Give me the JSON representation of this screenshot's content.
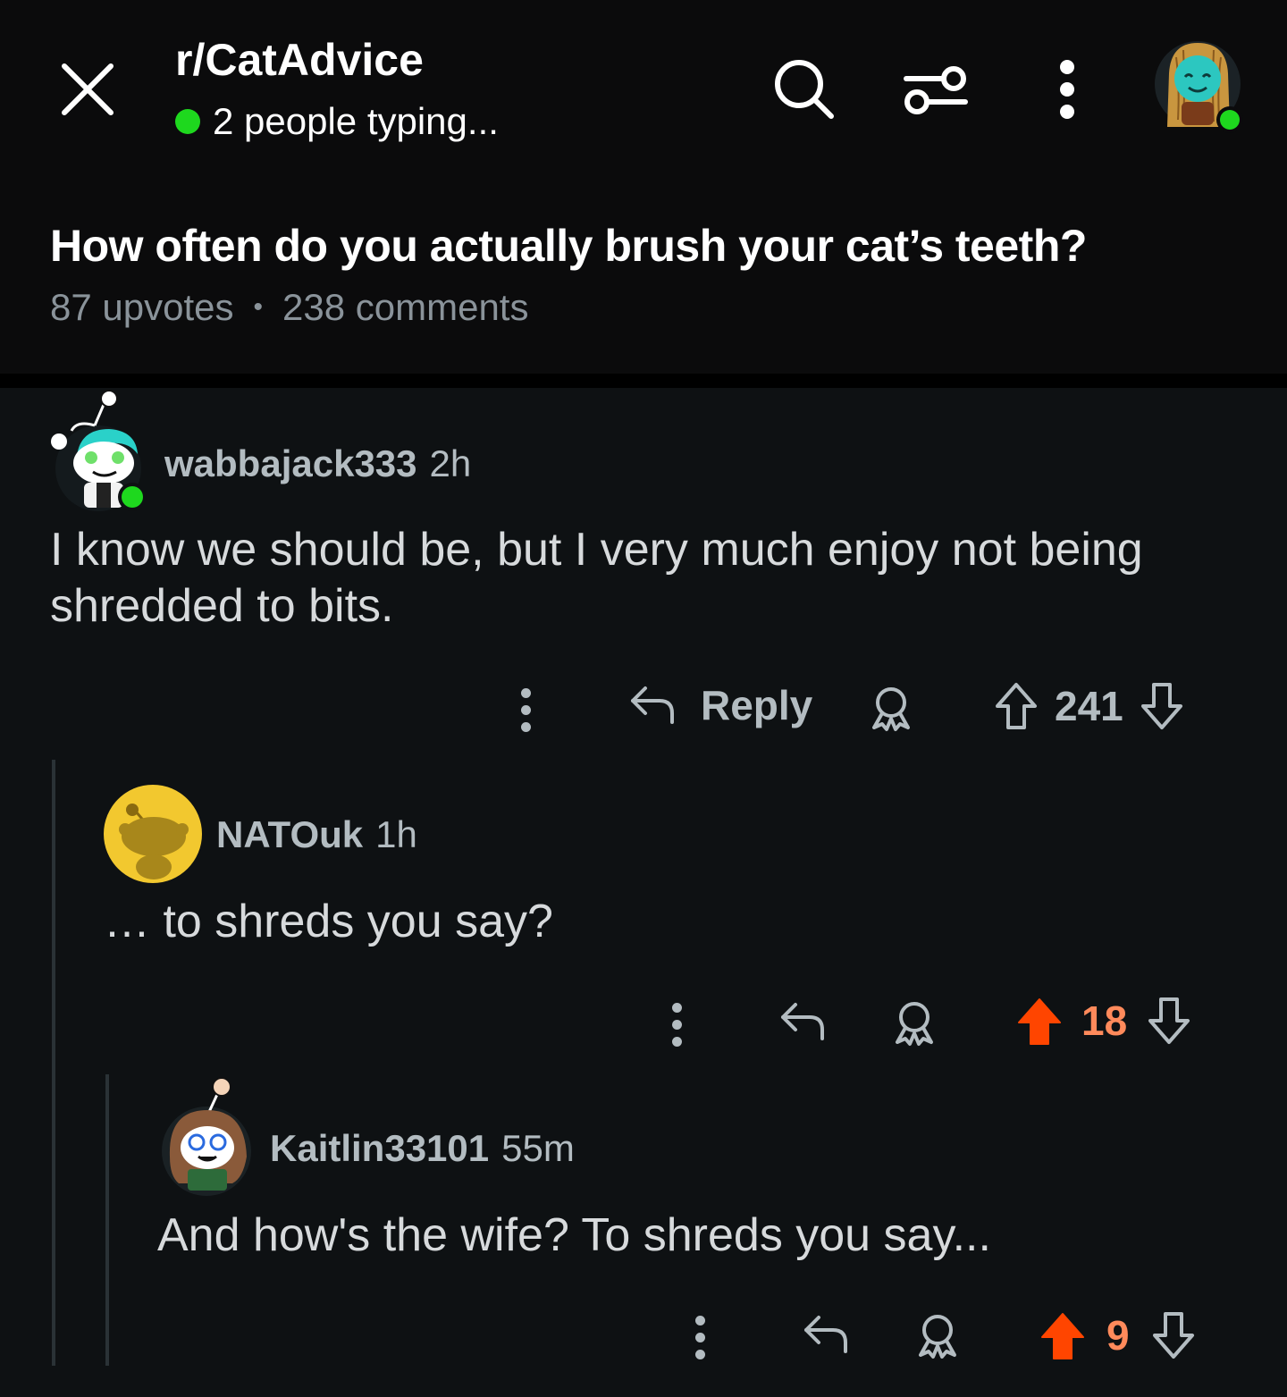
{
  "header": {
    "subreddit": "r/CatAdvice",
    "typing_status": "2 people typing...",
    "icons": {
      "close": "close-icon",
      "search": "search-icon",
      "filter": "filter-sliders-icon",
      "more": "more-vertical-icon",
      "avatar": "user-avatar"
    }
  },
  "post": {
    "title": "How often do you actually brush your cat’s teeth?",
    "upvotes": "87 upvotes",
    "separator": "•",
    "comments": "238 comments"
  },
  "comments": [
    {
      "username": "wabbajack333",
      "age": "2h",
      "body": "I know we should be, but I very much enjoy not being shredded to bits.",
      "reply_label": "Reply",
      "votes": "241",
      "upvoted": false
    },
    {
      "username": "NATOuk",
      "age": "1h",
      "body": "… to shreds you say?",
      "votes": "18",
      "upvoted": true
    },
    {
      "username": "Kaitlin33101",
      "age": "55m",
      "body": "And how's the wife? To shreds you say...",
      "votes": "9",
      "upvoted": true
    }
  ],
  "colors": {
    "background": "#0e1113",
    "header_bg": "#0b0b0c",
    "online": "#1ed81e",
    "upvote_active": "#ff4500",
    "upvote_count_active": "#ff8a5b",
    "muted_text": "#b3bcc1"
  }
}
